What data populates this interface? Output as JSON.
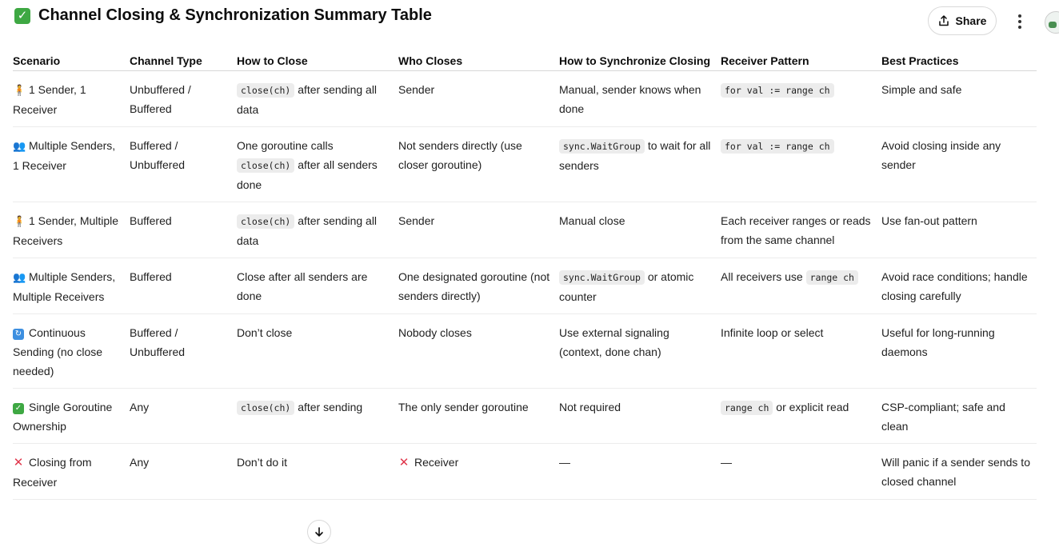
{
  "page": {
    "title": "Channel Closing & Synchronization Summary Table",
    "title_icon": "check-mark-button-icon"
  },
  "header": {
    "share_label": "Share"
  },
  "table": {
    "columns": [
      "Scenario",
      "Channel Type",
      "How to Close",
      "Who Closes",
      "How to Synchronize Closing",
      "Receiver Pattern",
      "Best Practices"
    ],
    "rows": [
      {
        "icon": "person-icon",
        "scenario": "1 Sender, 1 Receiver",
        "channel_type": "Unbuffered / Buffered",
        "close_code": "close(ch)",
        "close_text": " after sending all data",
        "who_closes": "Sender",
        "sync_code": "",
        "sync_text": "Manual, sender knows when done",
        "recv_code": "for val := range ch",
        "recv_text": "",
        "best": "Simple and safe"
      },
      {
        "icon": "people-icon",
        "scenario": "Multiple Senders, 1 Receiver",
        "channel_type": "Buffered / Unbuffered",
        "close_pre": "One goroutine calls ",
        "close_code": "close(ch)",
        "close_text": " after all senders done",
        "who_closes": "Not senders directly (use closer goroutine)",
        "sync_code": "sync.WaitGroup",
        "sync_text": " to wait for all senders",
        "recv_code": "for val := range ch",
        "recv_text": "",
        "best": "Avoid closing inside any sender"
      },
      {
        "icon": "person-icon",
        "scenario": "1 Sender, Multiple Receivers",
        "channel_type": "Buffered",
        "close_code": "close(ch)",
        "close_text": " after sending all data",
        "who_closes": "Sender",
        "sync_code": "",
        "sync_text": "Manual close",
        "recv_code": "",
        "recv_text": "Each receiver ranges or reads from the same channel",
        "best": "Use fan-out pattern"
      },
      {
        "icon": "people-icon",
        "scenario": "Multiple Senders, Multiple Receivers",
        "channel_type": "Buffered",
        "close_code": "",
        "close_text": "Close after all senders are done",
        "who_closes": "One designated goroutine (not senders directly)",
        "sync_code": "sync.WaitGroup",
        "sync_text": " or atomic counter",
        "recv_pre": "All receivers use ",
        "recv_code": "range ch",
        "recv_text": "",
        "best": "Avoid race conditions; handle closing carefully"
      },
      {
        "icon": "cycle-arrows-icon",
        "scenario": "Continuous Sending (no close needed)",
        "channel_type": "Buffered / Unbuffered",
        "close_code": "",
        "close_text": "Don’t close",
        "who_closes": "Nobody closes",
        "sync_code": "",
        "sync_text": "Use external signaling (context, done chan)",
        "recv_code": "",
        "recv_text": "Infinite loop or select",
        "best": "Useful for long-running daemons"
      },
      {
        "icon": "check-mark-icon",
        "scenario": "Single Goroutine Ownership",
        "channel_type": "Any",
        "close_code": "close(ch)",
        "close_text": " after sending",
        "who_closes": "The only sender goroutine",
        "sync_code": "",
        "sync_text": "Not required",
        "recv_code": "range ch",
        "recv_text": " or explicit read",
        "best": "CSP-compliant; safe and clean"
      },
      {
        "icon": "cross-mark-icon",
        "scenario": "Closing from Receiver",
        "channel_type": "Any",
        "close_code": "",
        "close_text": "Don’t do it",
        "who_icon": "cross-mark-icon",
        "who_closes": "Receiver",
        "sync_code": "",
        "sync_text": "—",
        "recv_code": "",
        "recv_text": "—",
        "best": "Will panic if a sender sends to closed channel"
      }
    ]
  }
}
